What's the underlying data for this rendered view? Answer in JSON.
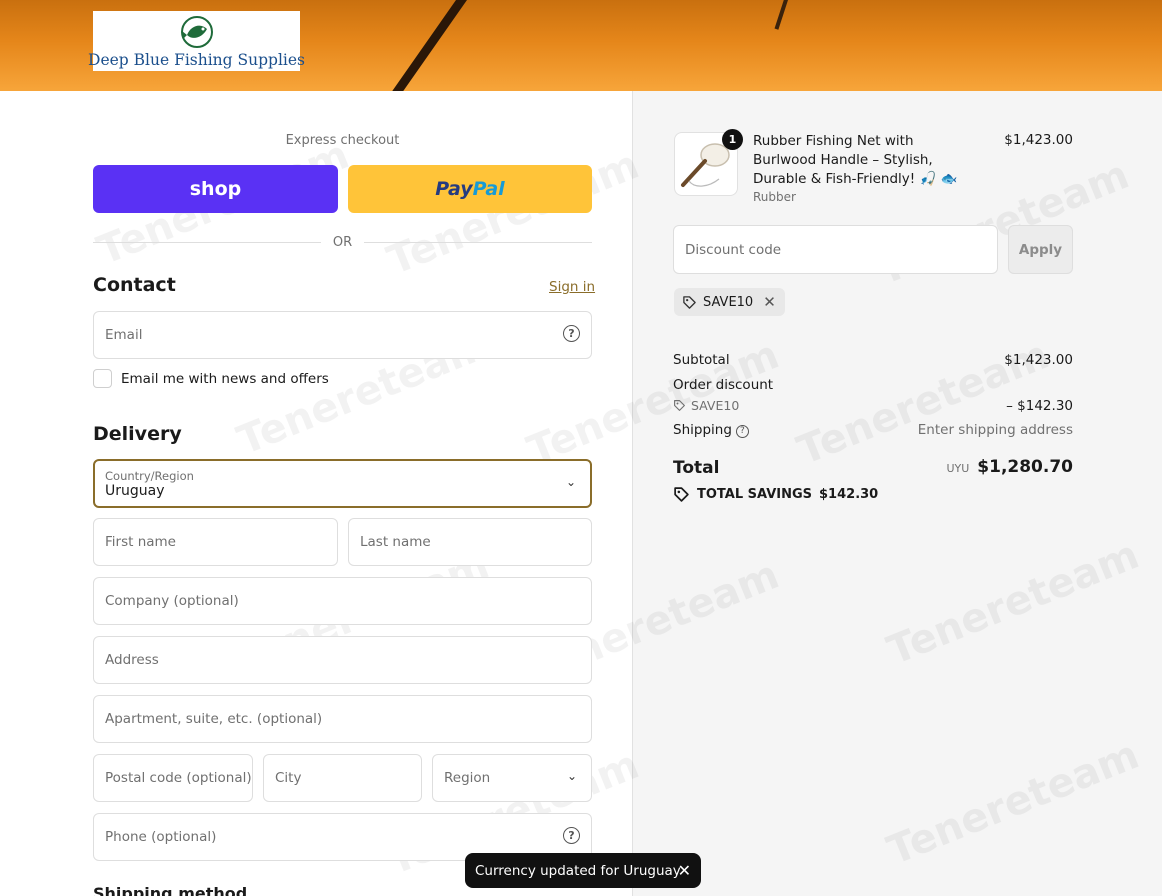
{
  "store": {
    "name": "Deep Blue Fishing Supplies"
  },
  "express": {
    "label": "Express checkout",
    "shop_label": "shop",
    "paypal_part1": "Pay",
    "paypal_part2": "Pal",
    "or_label": "OR"
  },
  "contact": {
    "title": "Contact",
    "signin_label": "Sign in",
    "email_placeholder": "Email",
    "newsletter_label": "Email me with news and offers"
  },
  "delivery": {
    "title": "Delivery",
    "country_label": "Country/Region",
    "country_value": "Uruguay",
    "first_name_placeholder": "First name",
    "last_name_placeholder": "Last name",
    "company_placeholder": "Company (optional)",
    "address_placeholder": "Address",
    "apartment_placeholder": "Apartment, suite, etc. (optional)",
    "postal_placeholder": "Postal code (optional)",
    "city_placeholder": "City",
    "region_placeholder": "Region",
    "phone_placeholder": "Phone (optional)"
  },
  "shipping_method": {
    "title": "Shipping method"
  },
  "toast": {
    "message": "Currency updated for Uruguay"
  },
  "summary": {
    "product": {
      "title": "Rubber Fishing Net with Burlwood Handle – Stylish, Durable & Fish-Friendly! 🎣 🐟",
      "variant": "Rubber",
      "price": "$1,423.00",
      "quantity": "1"
    },
    "discount_placeholder": "Discount code",
    "apply_label": "Apply",
    "applied_code": "SAVE10",
    "subtotal_label": "Subtotal",
    "subtotal_value": "$1,423.00",
    "order_discount_label": "Order discount",
    "order_discount_code": "SAVE10",
    "order_discount_value": "– $142.30",
    "shipping_label": "Shipping",
    "shipping_value": "Enter shipping address",
    "total_label": "Total",
    "total_currency": "UYU",
    "total_value": "$1,280.70",
    "savings_label": "TOTAL SAVINGS",
    "savings_value": "$142.30"
  },
  "colors": {
    "shop_purple": "#5a31f4",
    "paypal_yellow": "#ffc439",
    "accent_brown": "#8a6d2a"
  }
}
